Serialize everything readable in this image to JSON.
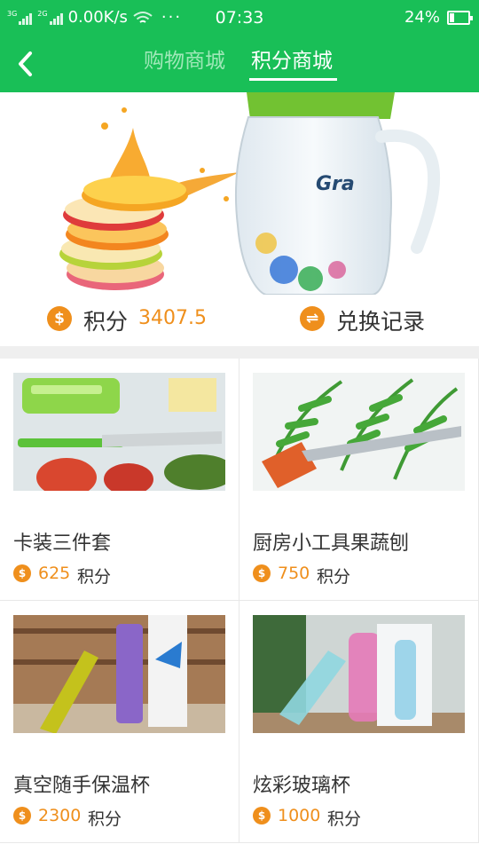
{
  "status_bar": {
    "network_tags": [
      "3G",
      "2G",
      "2G"
    ],
    "speed": "0.00K/s",
    "more": "···",
    "time": "07:33",
    "battery_percent": "24%",
    "battery_level": 0.24
  },
  "nav": {
    "back_icon": "back-arrow-icon",
    "tabs": [
      {
        "label": "购物商城",
        "active": false
      },
      {
        "label": "积分商城",
        "active": true
      }
    ]
  },
  "banner": {
    "jar_label": "Gra"
  },
  "points_bar": {
    "points_icon": "$",
    "points_label": "积分",
    "points_value": "3407.5",
    "records_icon": "⇌",
    "records_label": "兑换记录"
  },
  "products": [
    {
      "name": "卡装三件套",
      "price": "625",
      "unit": "积分",
      "image": "knife-peeler-set-photo"
    },
    {
      "name": "厨房小工具果蔬刨",
      "price": "750",
      "unit": "积分",
      "image": "vegetable-grater-photo"
    },
    {
      "name": "真空随手保温杯",
      "price": "2300",
      "unit": "积分",
      "image": "thermos-bottles-photo"
    },
    {
      "name": "炫彩玻璃杯",
      "price": "1000",
      "unit": "积分",
      "image": "glass-bottles-photo"
    }
  ],
  "colors": {
    "brand_green": "#19bf57",
    "accent_orange": "#ef8f1c",
    "inactive_tab": "#9fe8b8"
  }
}
